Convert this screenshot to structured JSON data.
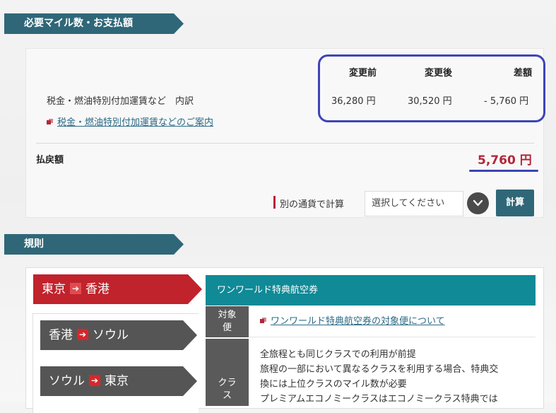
{
  "payment_section": {
    "title": "必要マイル数・お支払額",
    "columns": {
      "before": "変更前",
      "after": "変更後",
      "diff": "差額"
    },
    "row_label": "税金・燃油特別付加運賃など　内訳",
    "values": {
      "before": "36,280 円",
      "after": "30,520 円",
      "diff": "- 5,760 円"
    },
    "info_link": "税金・燃油特別付加運賃などのご案内",
    "refund_label": "払戻額",
    "refund_amount": "5,760 円",
    "currency_label": "別の通貨で計算",
    "currency_select": "選択してください",
    "calc_button": "計算"
  },
  "rules_section": {
    "title": "規則",
    "routes": [
      {
        "from": "東京",
        "to": "香港",
        "active": true
      },
      {
        "from": "香港",
        "to": "ソウル",
        "active": false
      },
      {
        "from": "ソウル",
        "to": "東京",
        "active": false
      }
    ],
    "arrow": "➔",
    "ticket_title": "ワンワールド特典航空券",
    "rows": [
      {
        "label_line1": "対象",
        "label_line2": "便",
        "link": "ワンワールド特典航空券の対象便について"
      },
      {
        "label_line1": "クラ",
        "label_line2": "ス",
        "lines": [
          "全旅程とも同じクラスでの利用が前提",
          "旅程の一部において異なるクラスを利用する場合、特典交",
          "換には上位クラスのマイル数が必要",
          "プレミアムエコノミークラスはエコノミークラス特典では"
        ]
      }
    ]
  },
  "colors": {
    "ribbon": "#2f6778",
    "active_route": "#c0232c",
    "inactive_route": "#555555",
    "teal": "#0f8a96",
    "refund": "#b3263a",
    "highlight": "#3e44b6"
  }
}
